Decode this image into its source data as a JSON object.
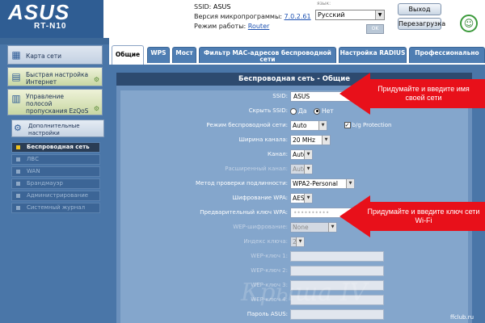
{
  "header": {
    "logo": "ASUS",
    "model": "RT-N10",
    "ssid_label": "SSID:",
    "ssid_value": "ASUS",
    "firmware_label": "Версия микропрограммы:",
    "firmware_value": "7.0.2.61",
    "mode_label": "Режим работы:",
    "mode_value": "Router",
    "language_label": "язык:",
    "language_value": "Русский",
    "ok_label": "OK",
    "logout_label": "Выход",
    "reboot_label": "Перезагрузка"
  },
  "sidebar": {
    "items": [
      {
        "label": "Карта сети",
        "icon": "network-map-icon"
      },
      {
        "label": "Быстрая настройка Интернет",
        "icon": "quick-setup-icon"
      },
      {
        "label": "Управление полосой пропускания EzQoS",
        "icon": "qos-icon"
      }
    ],
    "advanced_label": "Дополнительные настройки",
    "sub_items": [
      {
        "label": "Беспроводная сеть",
        "active": true
      },
      {
        "label": "ЛВС",
        "active": false
      },
      {
        "label": "WAN",
        "active": false
      },
      {
        "label": "Брандмауэр",
        "active": false
      },
      {
        "label": "Администрирование",
        "active": false
      },
      {
        "label": "Системный журнал",
        "active": false
      }
    ]
  },
  "tabs": [
    {
      "label": "Общие",
      "active": true
    },
    {
      "label": "WPS",
      "active": false
    },
    {
      "label": "Мост",
      "active": false
    },
    {
      "label": "Фильтр MAC-адресов беспроводной сети",
      "active": false
    },
    {
      "label": "Настройка RADIUS",
      "active": false
    },
    {
      "label": "Профессионально",
      "active": false
    }
  ],
  "panel": {
    "title": "Беспроводная сеть - Общие",
    "fields": {
      "ssid": {
        "label": "SSID:",
        "value": "ASUS"
      },
      "hide_ssid": {
        "label": "Скрыть SSID:",
        "yes": "Да",
        "no": "Нет",
        "selected": "no"
      },
      "wireless_mode": {
        "label": "Режим беспроводной сети:",
        "value": "Auto",
        "bg_protection": "b/g Protection",
        "bg_checked": true
      },
      "channel_width": {
        "label": "Ширина канала:",
        "value": "20 MHz"
      },
      "channel": {
        "label": "Канал:",
        "value": "Auto"
      },
      "ext_channel": {
        "label": "Расширенный канал:",
        "value": "Auto"
      },
      "auth_method": {
        "label": "Метод проверки подлинности:",
        "value": "WPA2-Personal"
      },
      "wpa_encryption": {
        "label": "Шифрование WPA:",
        "value": "AES"
      },
      "wpa_key": {
        "label": "Предварительный ключ WPA:",
        "value": "••••••••••"
      },
      "wep_encryption": {
        "label": "WEP-шифрование:",
        "value": "None"
      },
      "key_index": {
        "label": "Индекс ключа:",
        "value": "2"
      },
      "wep_key1": {
        "label": "WEP-ключ 1:",
        "value": ""
      },
      "wep_key2": {
        "label": "WEP-ключ 2:",
        "value": ""
      },
      "wep_key3": {
        "label": "WEP-ключ 3:",
        "value": ""
      },
      "wep_key4": {
        "label": "WEP-ключ 4:",
        "value": ""
      },
      "asus_password": {
        "label": "Пароль ASUS:",
        "value": ""
      }
    }
  },
  "callouts": {
    "ssid_hint": "Придумайте и введите имя своей сети",
    "key_hint": "Придумайте и введите ключ сети Wi-Fi"
  },
  "watermark": "Крыша IV",
  "footer_site": "ffclub.ru",
  "colors": {
    "brand_blue": "#2f5d93",
    "callout_red": "#e8101a"
  }
}
